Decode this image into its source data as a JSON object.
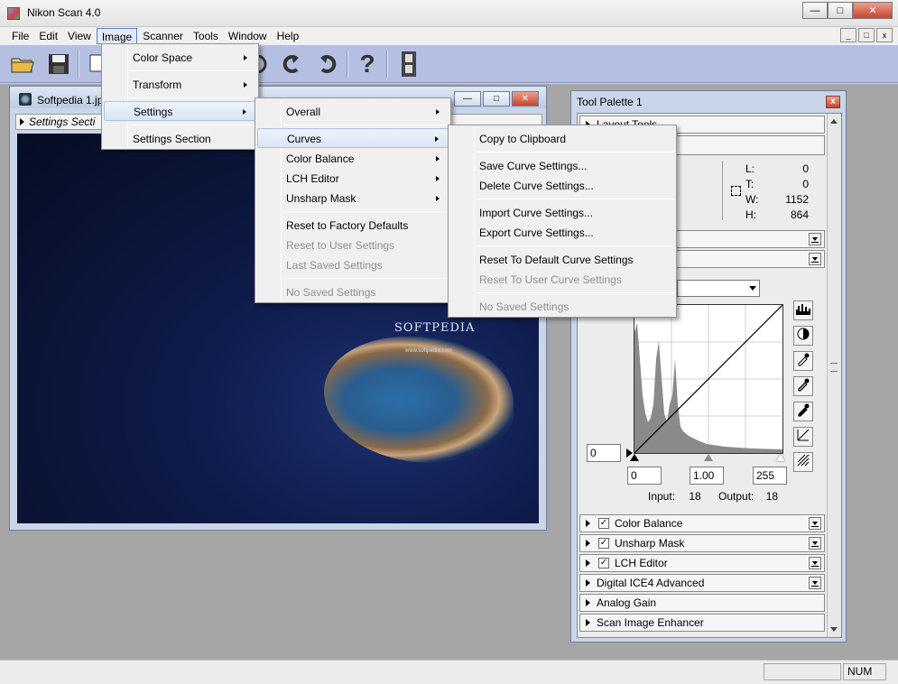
{
  "app": {
    "title": "Nikon Scan 4.0"
  },
  "menubar": {
    "items": [
      "File",
      "Edit",
      "View",
      "Image",
      "Scanner",
      "Tools",
      "Window",
      "Help"
    ]
  },
  "image_menu": {
    "items": [
      {
        "label": "Color Space",
        "submenu": true
      },
      {
        "label": "Transform",
        "submenu": true
      },
      {
        "label": "Settings",
        "submenu": true
      },
      {
        "label": "Settings Section",
        "submenu": false
      }
    ]
  },
  "settings_menu": {
    "items": [
      {
        "label": "Overall",
        "submenu": true
      },
      {
        "label": "Curves",
        "submenu": true
      },
      {
        "label": "Color Balance",
        "submenu": true
      },
      {
        "label": "LCH Editor",
        "submenu": true
      },
      {
        "label": "Unsharp Mask",
        "submenu": true
      },
      {
        "label": "Reset to Factory Defaults"
      },
      {
        "label": "Reset to User Settings",
        "disabled": true
      },
      {
        "label": "Last Saved Settings",
        "disabled": true
      },
      {
        "label": "No Saved Settings",
        "disabled": true
      }
    ]
  },
  "curves_menu": {
    "items": [
      {
        "label": "Copy to Clipboard"
      },
      {
        "label": "Save Curve Settings..."
      },
      {
        "label": "Delete Curve Settings..."
      },
      {
        "label": "Import Curve Settings..."
      },
      {
        "label": "Export Curve Settings..."
      },
      {
        "label": "Reset To Default Curve Settings"
      },
      {
        "label": "Reset To User Curve Settings",
        "disabled": true
      },
      {
        "label": "No Saved Settings",
        "disabled": true
      }
    ]
  },
  "document": {
    "title": "Softpedia 1.jp",
    "settings_section": "Settings Secti",
    "watermark": "SOFTPEDIA",
    "watermark_url": "www.softpedia.com"
  },
  "palette": {
    "title": "Tool Palette 1",
    "layout_tools": "Layout Tools",
    "crop": {
      "L_label": "L:",
      "L": "0",
      "T_label": "T:",
      "T": "0",
      "W_label": "W:",
      "W": "1152",
      "H_label": "H:",
      "H": "864"
    },
    "curves": {
      "left_field": "0",
      "black_point": "0",
      "gamma": "1.00",
      "white_point": "255",
      "input_label": "Input:",
      "input": "18",
      "output_label": "Output:",
      "output": "18"
    },
    "sections": [
      {
        "label": "Color Balance",
        "checked": true
      },
      {
        "label": "Unsharp Mask",
        "checked": true
      },
      {
        "label": "LCH Editor",
        "checked": true
      },
      {
        "label": "Digital ICE4 Advanced",
        "checked": false
      },
      {
        "label": "Analog Gain",
        "checked": false
      },
      {
        "label": "Scan Image Enhancer",
        "checked": false
      }
    ]
  },
  "statusbar": {
    "num": "NUM"
  }
}
